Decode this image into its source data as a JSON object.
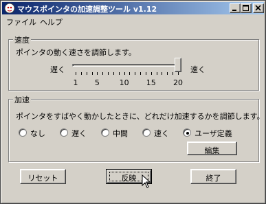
{
  "window": {
    "title": "マウスポインタの加速調整ツール v1.12"
  },
  "menu": {
    "items": [
      "ファイル",
      "ヘルプ"
    ]
  },
  "speed": {
    "group_title": "速度",
    "description": "ポインタの動く速さを調節します。",
    "slow_label": "遅く",
    "fast_label": "速く",
    "min": 1,
    "max": 20,
    "value": 20,
    "tick_labels": [
      "1",
      "5",
      "10",
      "15",
      "20"
    ]
  },
  "accel": {
    "group_title": "加速",
    "description": "ポインタをすばやく動かしたときに、どれだけ加速するかを調節します。",
    "options": [
      "なし",
      "遅く",
      "中間",
      "速く",
      "ユーザ定義"
    ],
    "selected": "ユーザ定義",
    "edit_label": "編集"
  },
  "buttons": {
    "reset": "リセット",
    "apply": "反映",
    "exit": "終了"
  },
  "colors": {
    "titlebar_start": "#0a246a",
    "titlebar_end": "#a6caf0",
    "face": "#d4d0c8"
  }
}
